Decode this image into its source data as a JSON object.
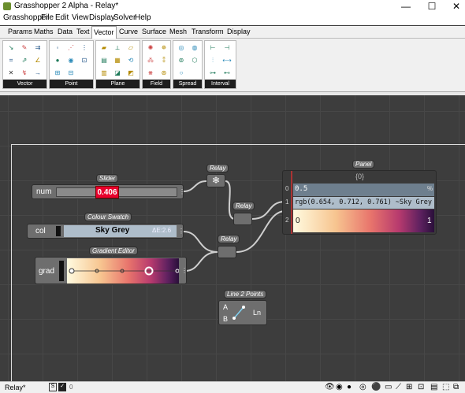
{
  "window": {
    "title": "Grasshopper 2 Alpha - Relay*",
    "minimize": "—",
    "maximize": "☐",
    "close": "✕"
  },
  "menu": [
    "Grasshopper",
    "File",
    "Edit",
    "View",
    "Display",
    "Solver",
    "Help"
  ],
  "tabs": [
    "Params",
    "Maths",
    "Data",
    "Text",
    "Vector",
    "Curve",
    "Surface",
    "Mesh",
    "Transform",
    "Display"
  ],
  "active_tab": "Vector",
  "ribbon_groups": [
    "Vector",
    "Point",
    "Plane",
    "Field",
    "Spread",
    "Interval"
  ],
  "nodes": {
    "slider": {
      "label": "Slider",
      "name": "num",
      "value": "0.406"
    },
    "swatch": {
      "label": "Colour Swatch",
      "name": "col",
      "value": "Sky Grey",
      "hint": "ΔE:2.6"
    },
    "gradient": {
      "label": "Gradient Editor",
      "name": "grad"
    },
    "relay1": {
      "label": "Relay",
      "icon": "snowflake-icon"
    },
    "relay2": {
      "label": "Relay"
    },
    "relay3": {
      "label": "Relay"
    },
    "panel": {
      "label": "Panel",
      "path": "{0}",
      "rows": [
        "0.5",
        "rgb(0.654, 0.712, 0.761) ~Sky Grey",
        ""
      ],
      "row_index": [
        "0",
        "1",
        "2"
      ],
      "grad_min": "0",
      "grad_max": "1",
      "pct": "%"
    },
    "line2pts": {
      "label": "Line 2 Points",
      "in_a": "A",
      "in_b": "B",
      "out": "Ln"
    }
  },
  "status": {
    "left": "Relay*",
    "count": "0"
  },
  "colors": {
    "slider_value_bg": "#e8002d",
    "swatch": "#aebdca",
    "gradient_stops": [
      "#fffbe0",
      "#f7c590",
      "#e8746c",
      "#b73a6e",
      "#5e2160",
      "#2a0f3a"
    ]
  }
}
